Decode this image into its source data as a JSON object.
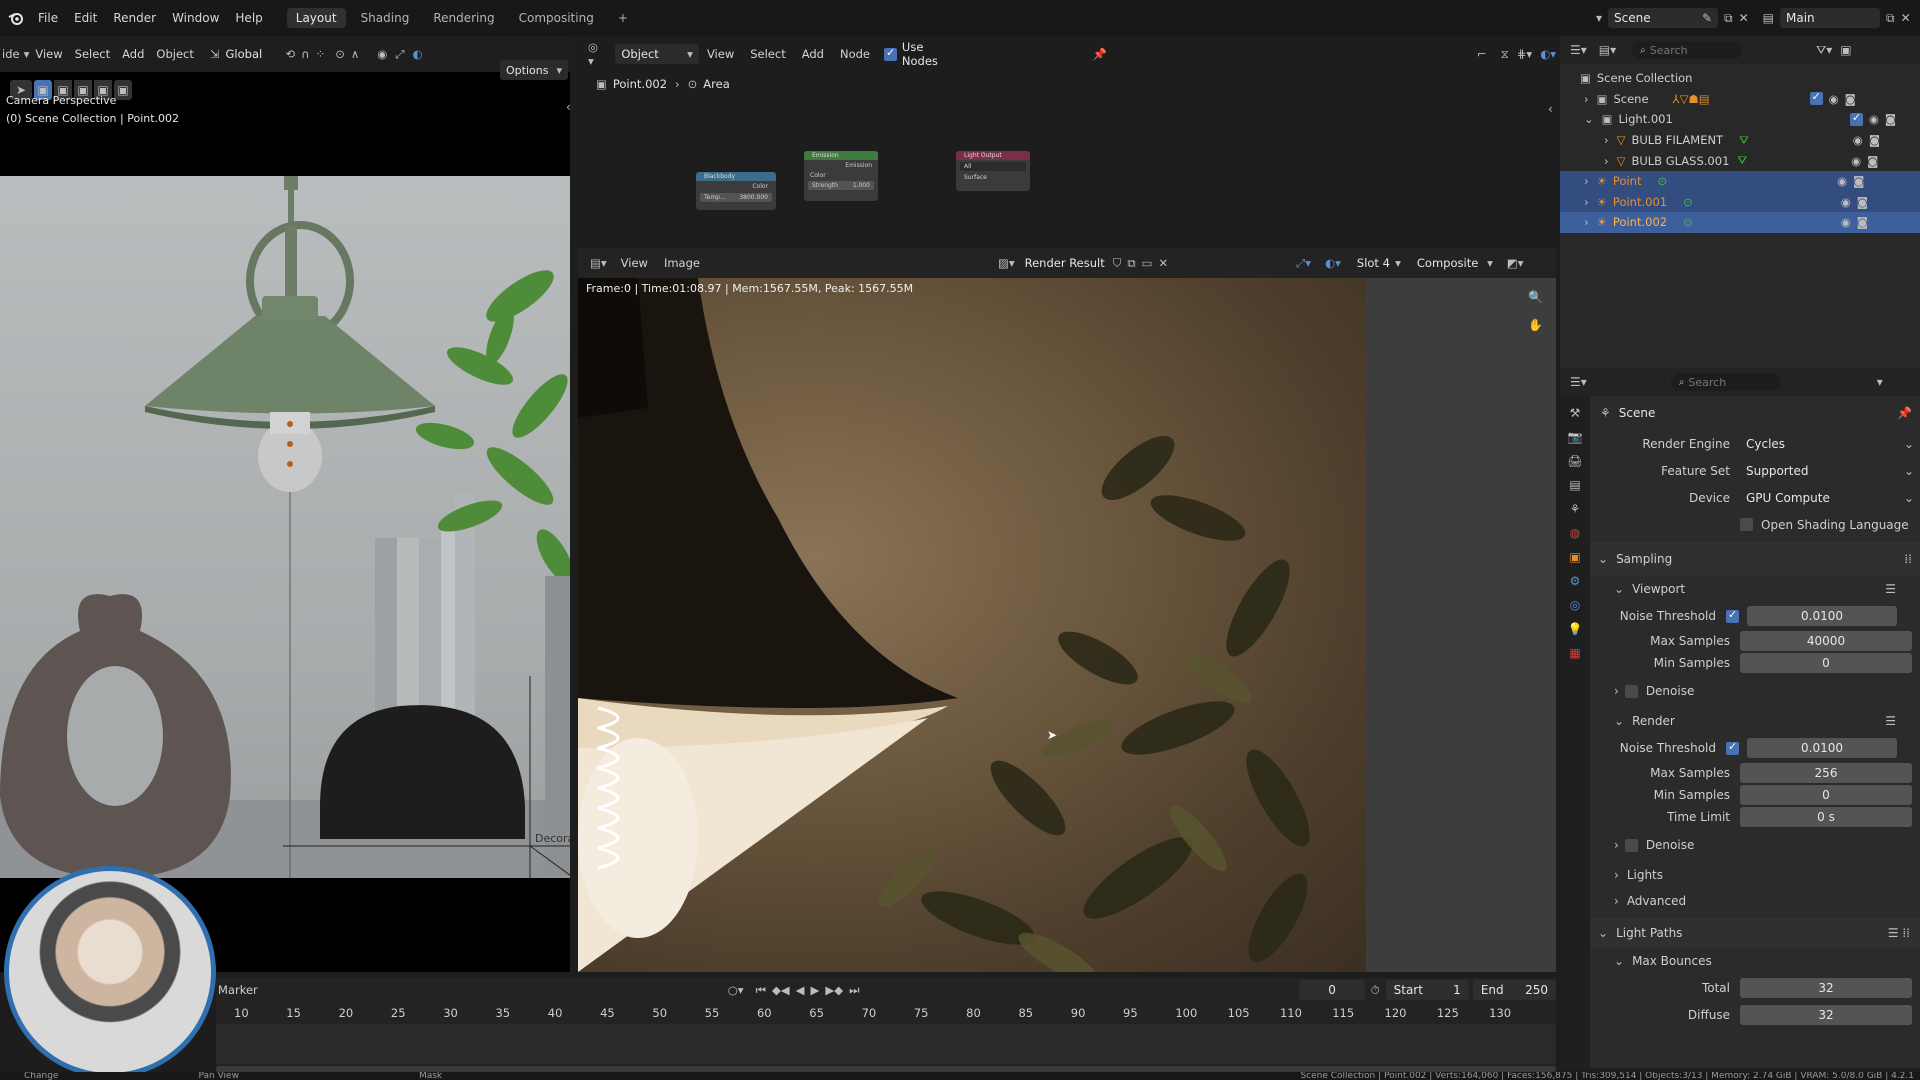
{
  "topbar": {
    "menu": [
      "File",
      "Edit",
      "Render",
      "Window",
      "Help"
    ],
    "workspaces": [
      "Layout",
      "Shading",
      "Rendering",
      "Compositing"
    ],
    "add_tab": "+",
    "scene": "Scene",
    "view_layer": "Main"
  },
  "viewport3d": {
    "header": {
      "mode_partial": "ide",
      "menus": [
        "View",
        "Select",
        "Add",
        "Object"
      ],
      "orientation": "Global",
      "options": "Options"
    },
    "overlay_line1": "Camera Perspective",
    "overlay_line2": "(0) Scene Collection | Point.002",
    "decor_label": "Decorat"
  },
  "node_editor": {
    "header": {
      "object_mode": "Object",
      "menus": [
        "View",
        "Select",
        "Add",
        "Node"
      ],
      "use_nodes": "Use Nodes"
    },
    "breadcrumb": [
      "Point.002",
      "Area"
    ],
    "nodes": {
      "blackbody": {
        "title": "Blackbody",
        "socket_out": "Color",
        "field": "Temp...",
        "value": "3800.000"
      },
      "emission": {
        "title": "Emission",
        "socket_out": "Emission",
        "socket_color": "Color",
        "strength": "Strength",
        "strength_val": "1.000"
      },
      "output": {
        "title": "Light Output",
        "target": "All",
        "socket": "Surface"
      }
    }
  },
  "image_editor": {
    "header": {
      "menus": [
        "View",
        "Image"
      ],
      "image_name": "Render Result",
      "slot": "Slot 4",
      "pass": "Composite"
    },
    "stats": "Frame:0 | Time:01:08.97 | Mem:1567.55M, Peak: 1567.55M"
  },
  "outliner": {
    "search_placeholder": "Search",
    "root": "Scene Collection",
    "items": [
      {
        "name": "Scene",
        "indent": 1
      },
      {
        "name": "Light.001",
        "indent": 1
      },
      {
        "name": "BULB FILAMENT",
        "indent": 2
      },
      {
        "name": "BULB GLASS.001",
        "indent": 2
      },
      {
        "name": "Point",
        "indent": 1
      },
      {
        "name": "Point.001",
        "indent": 1
      },
      {
        "name": "Point.002",
        "indent": 1
      }
    ]
  },
  "properties": {
    "search_placeholder": "Search",
    "context": "Scene",
    "render_engine_label": "Render Engine",
    "render_engine": "Cycles",
    "feature_set_label": "Feature Set",
    "feature_set": "Supported",
    "device_label": "Device",
    "device": "GPU Compute",
    "osl": "Open Shading Language",
    "sampling": "Sampling",
    "viewport": "Viewport",
    "noise_threshold": "Noise Threshold",
    "vp_noise": "0.0100",
    "max_samples": "Max Samples",
    "vp_max": "40000",
    "min_samples": "Min Samples",
    "vp_min": "0",
    "denoise": "Denoise",
    "render": "Render",
    "r_noise": "0.0100",
    "r_max": "256",
    "r_min": "0",
    "time_limit": "Time Limit",
    "r_time": "0 s",
    "denoise2": "Denoise",
    "lights": "Lights",
    "advanced": "Advanced",
    "light_paths": "Light Paths",
    "max_bounces": "Max Bounces",
    "total": "Total",
    "total_val": "32",
    "diffuse": "Diffuse",
    "diffuse_val": "32"
  },
  "timeline": {
    "marker": "Marker",
    "current_frame": "0",
    "start_label": "Start",
    "start": "1",
    "end_label": "End",
    "end": "250",
    "ticks": [
      "10",
      "15",
      "20",
      "25",
      "30",
      "35",
      "40",
      "45",
      "50",
      "55",
      "60",
      "65",
      "70",
      "75",
      "80",
      "85",
      "90",
      "95",
      "100",
      "105",
      "110",
      "115",
      "120",
      "125",
      "130"
    ]
  },
  "statusbar": {
    "left1": "Change",
    "left2": "Pan View",
    "left3": "Mask",
    "right": "Scene Collection | Point.002 | Verts:164,060 | Faces:156,875 | Tris:309,514 | Objects:3/13 | Memory: 2.74 GiB | VRAM: 5.0/8.0 GiB | 4.2.1"
  }
}
